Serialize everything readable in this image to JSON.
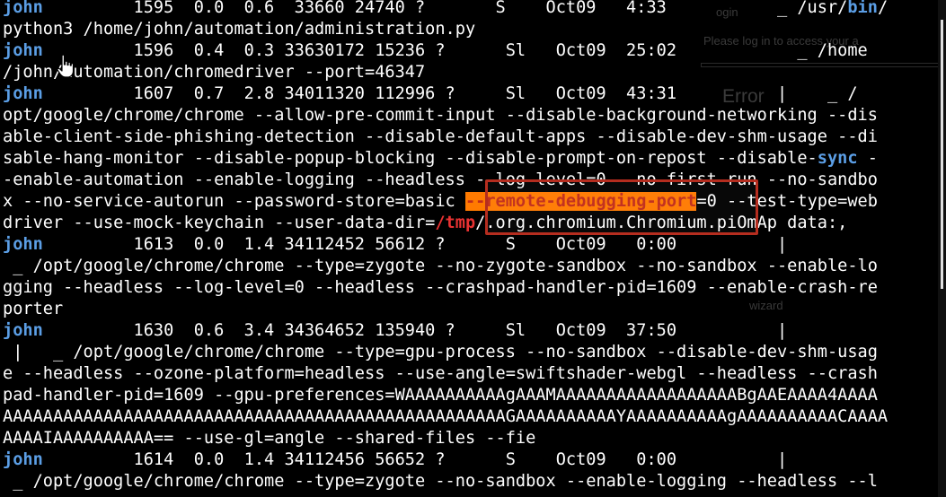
{
  "background_ui": {
    "login": "ogin",
    "prompt": "Please log in to access your a",
    "error": "Error",
    "wizard": "wizard"
  },
  "lines": [
    [
      {
        "t": "john",
        "c": "user"
      },
      {
        "t": "         1595  0.0  0.6  33660 24740 ?       S    Oct09   4:33           _ /usr/"
      },
      {
        "t": "bin",
        "c": "user"
      },
      {
        "t": "/"
      }
    ],
    [
      {
        "t": "python3 /home/john/automation/administration.py"
      }
    ],
    [
      {
        "t": "john",
        "c": "user"
      },
      {
        "t": "         1596  0.4  0.3 33630172 15236 ?      Sl   Oct09  25:02            _ /home"
      }
    ],
    [
      {
        "t": "/john/automation/chromedriver --port=46347"
      }
    ],
    [
      {
        "t": "john",
        "c": "user"
      },
      {
        "t": "         1607  0.7  2.8 34011320 112996 ?     Sl   Oct09  43:31          |    _ /"
      }
    ],
    [
      {
        "t": "opt/google/chrome/chrome --allow-pre-commit-input --disable-background-networking --dis"
      }
    ],
    [
      {
        "t": "able-client-side-phishing-detection --disable-default-apps --disable-dev-shm-usage --di"
      }
    ],
    [
      {
        "t": "sable-hang-monitor --disable-popup-blocking --disable-prompt-on-repost --disable-"
      },
      {
        "t": "sync",
        "c": "sync"
      },
      {
        "t": " -"
      }
    ],
    [
      {
        "t": "-enable-automation --enable-logging --headless --log-level=0 --no-first-run --no-sandbo"
      }
    ],
    [
      {
        "t": "x --no-service-autorun --password-store=basic "
      },
      {
        "t": "--remote-debugging-port",
        "c": "hl"
      },
      {
        "t": "=0 --test-type=web"
      }
    ],
    [
      {
        "t": "driver --use-mock-keychain --user-data-dir="
      },
      {
        "t": "/tmp",
        "c": "tmp"
      },
      {
        "t": "/.org.chromium.Chromium.piOmAp data:,"
      }
    ],
    [
      {
        "t": "john",
        "c": "user"
      },
      {
        "t": "         1613  0.0  1.4 34112452 56612 ?      S    Oct09   0:00          |"
      }
    ],
    [
      {
        "t": " _ /opt/google/chrome/chrome --type=zygote --no-zygote-sandbox --no-sandbox --enable-lo"
      }
    ],
    [
      {
        "t": "gging --headless --log-level=0 --headless --crashpad-handler-pid=1609 --enable-crash-re"
      }
    ],
    [
      {
        "t": "porter"
      }
    ],
    [
      {
        "t": "john",
        "c": "user"
      },
      {
        "t": "         1630  0.6  3.4 34364652 135940 ?     Sl   Oct09  37:50          |"
      }
    ],
    [
      {
        "t": " |   _ /opt/google/chrome/chrome --type=gpu-process --no-sandbox --disable-dev-shm-usag"
      }
    ],
    [
      {
        "t": "e --headless --ozone-platform=headless --use-angle=swiftshader-webgl --headless --crash"
      }
    ],
    [
      {
        "t": "pad-handler-pid=1609 --gpu-preferences=WAAAAAAAAAAgAAAMAAAAAAAAAAAAAAAAAABgAAEAAAA4AAAA"
      }
    ],
    [
      {
        "t": "AAAAAAAAAAAAAAAAAAAAAAAAAAAAAAAAAAAAAAAAAAAAAAAAAAGAAAAAAAAAAYAAAAAAAAAAgAAAAAAAAAACAAAA"
      }
    ],
    [
      {
        "t": "AAAAIAAAAAAAAAA== --use-gl=angle --shared-files --fie"
      }
    ],
    [
      {
        "t": "john",
        "c": "user"
      },
      {
        "t": "         1614  0.0  1.4 34112456 56652 ?      S    Oct09   0:00          |"
      }
    ],
    [
      {
        "t": " _ /opt/google/chrome/chrome --type=zygote --no-sandbox --enable-logging --headless --l"
      }
    ]
  ],
  "highlight": {
    "label": "--remote-debugging-port",
    "accent": "#ff7a00",
    "border": "#b52d1f"
  },
  "colors": {
    "user": "#5b9ee5",
    "tmp": "#e83232",
    "background": "#000000",
    "text": "#ffffff"
  }
}
